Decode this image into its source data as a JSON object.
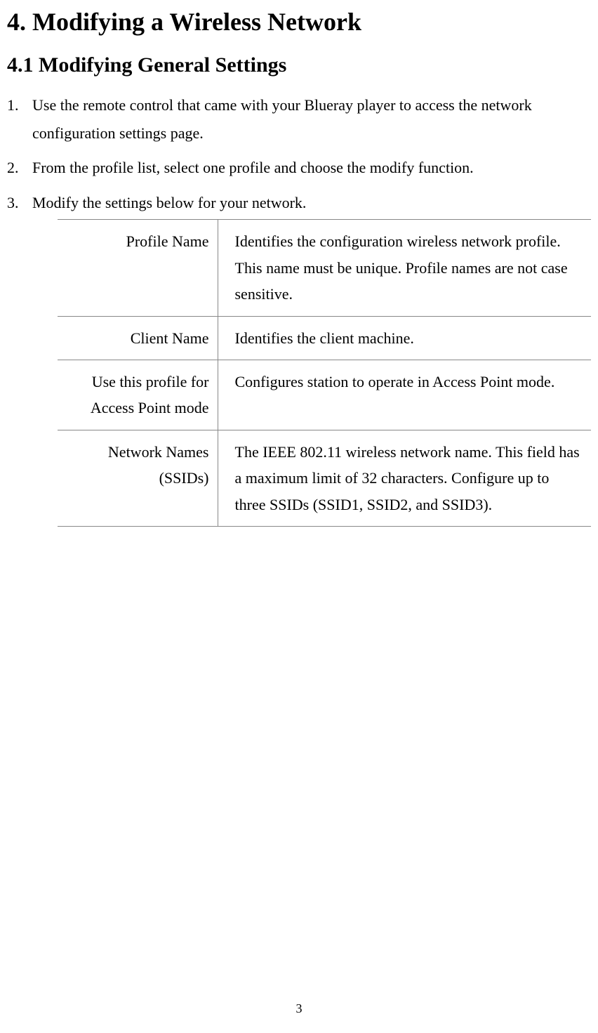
{
  "section": {
    "heading": "4. Modifying a Wireless Network",
    "subheading": "4.1 Modifying General Settings"
  },
  "steps": [
    "Use the remote control that came with your Blueray player to access the network configuration settings page.",
    "From the profile list, select one profile and choose the modify function.",
    "Modify the settings below for your network."
  ],
  "table": {
    "rows": [
      {
        "label": "Profile Name",
        "desc": "Identifies the configuration wireless network profile. This name must be unique. Profile names are not case sensitive."
      },
      {
        "label": "Client Name",
        "desc": "Identifies the client machine."
      },
      {
        "label": "Use this profile for Access Point mode",
        "desc": "Configures station to operate in Access Point mode."
      },
      {
        "label": "Network Names (SSIDs)",
        "desc": "The IEEE 802.11 wireless network name. This field has a maximum limit of 32 characters. Configure up to three SSIDs (SSID1, SSID2, and SSID3)."
      }
    ]
  },
  "page_number": "3"
}
